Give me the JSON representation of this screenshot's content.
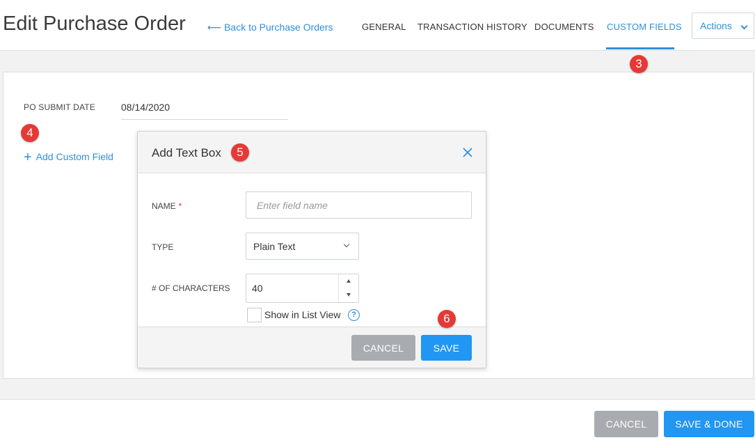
{
  "header": {
    "title": "Edit Purchase Order",
    "back_link": "Back to Purchase Orders",
    "back_arrow": "⟵",
    "tabs": [
      {
        "label": "GENERAL"
      },
      {
        "label": "TRANSACTION HISTORY"
      },
      {
        "label": "DOCUMENTS"
      },
      {
        "label": "CUSTOM FIELDS",
        "active": true
      }
    ],
    "actions_label": "Actions"
  },
  "steps": [
    "3",
    "4",
    "5",
    "6"
  ],
  "form": {
    "po_submit_date_label": "PO SUBMIT DATE",
    "po_submit_date_value": "08/14/2020",
    "add_custom_field_label": "Add Custom Field",
    "plus_glyph": "+"
  },
  "modal": {
    "title": "Add Text Box",
    "close_glyph": "×",
    "name_label": "NAME",
    "required_mark": "*",
    "name_placeholder": "Enter field name",
    "type_label": "TYPE",
    "type_value": "Plain Text",
    "chars_label": "# OF CHARACTERS",
    "chars_value": "40",
    "show_in_list_label": "Show in List View",
    "help_glyph": "?",
    "cancel_label": "CANCEL",
    "save_label": "SAVE"
  },
  "footer": {
    "cancel_label": "CANCEL",
    "save_done_label": "SAVE & DONE"
  },
  "colors": {
    "accent": "#2f8fdc",
    "badge": "#e53935",
    "primary_button": "#2196f3",
    "secondary_button": "#a8acb0"
  }
}
